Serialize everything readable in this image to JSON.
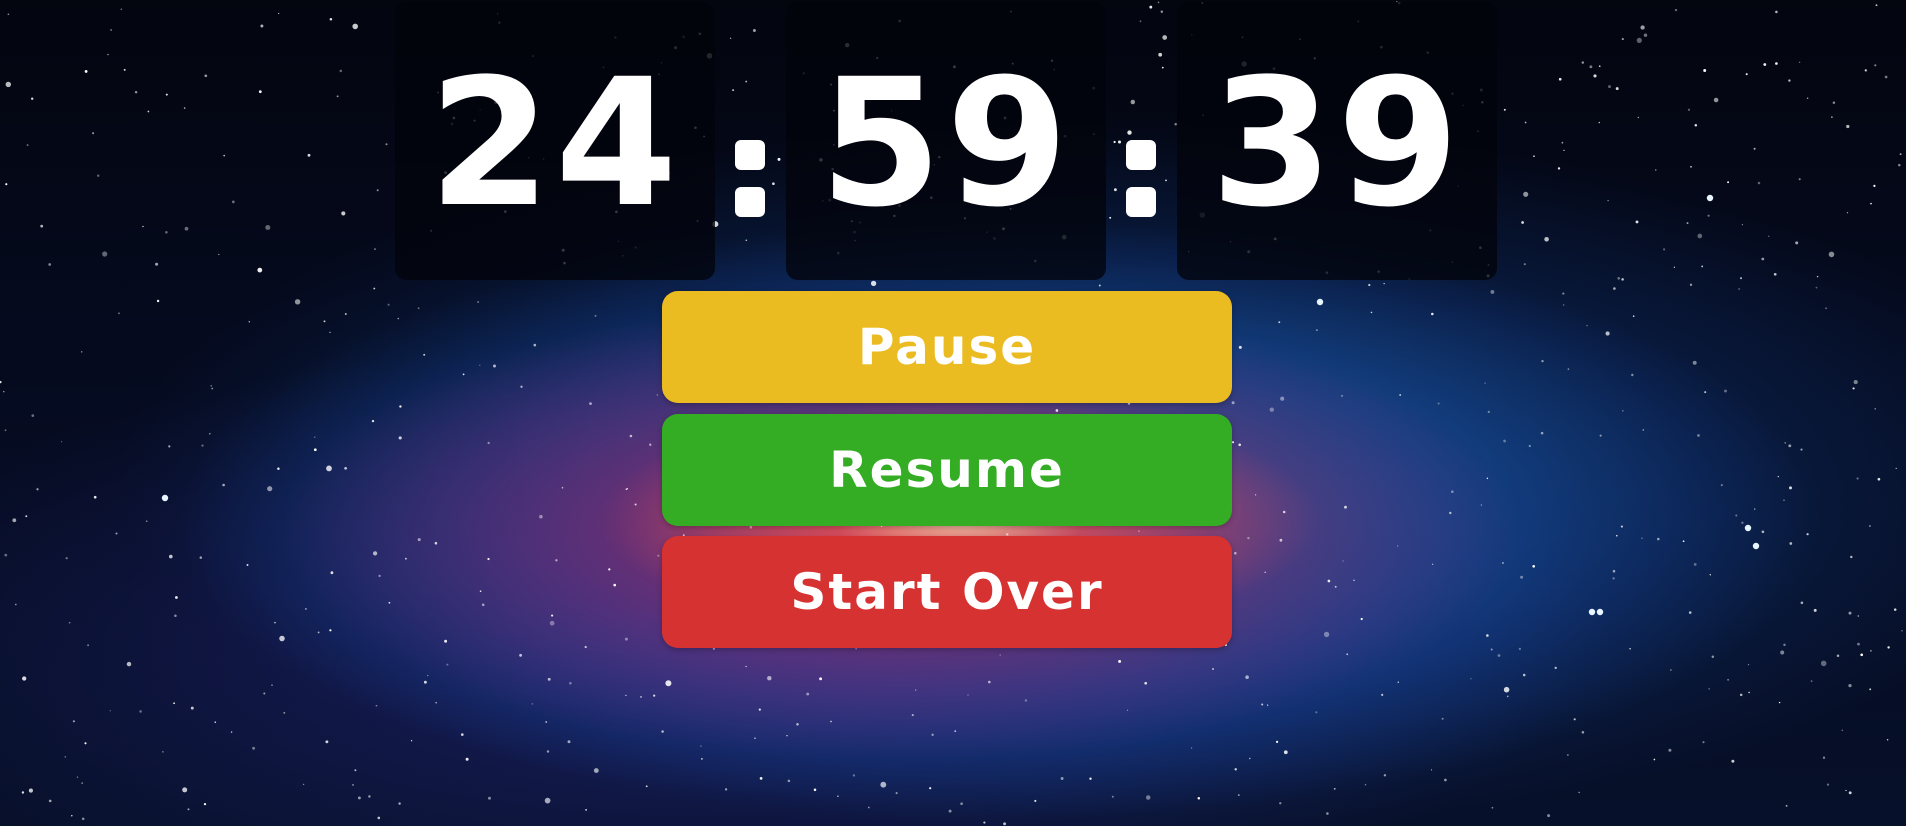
{
  "timer": {
    "hours": "24",
    "minutes": "59",
    "seconds": "39"
  },
  "buttons": {
    "pause_label": "Pause",
    "resume_label": "Resume",
    "start_over_label": "Start Over"
  },
  "colors": {
    "pause": "#ebbb22",
    "resume": "#34ad25",
    "start_over": "#d73232",
    "text": "#ffffff",
    "tile": "#02040c"
  }
}
